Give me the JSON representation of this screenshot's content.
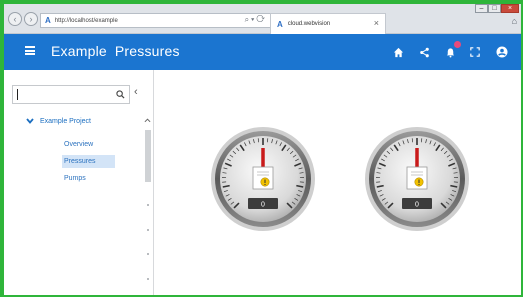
{
  "browser": {
    "url": "http://localhost/example",
    "tab_title": "cloud.webvision",
    "tab_close": "×",
    "window_controls": [
      "–",
      "□",
      "×"
    ]
  },
  "appbar": {
    "title_part1": "Example",
    "title_part2": "Pressures",
    "icons": [
      "home-icon",
      "share-icon",
      "bell-icon",
      "fullscreen-icon",
      "account-icon"
    ],
    "accent_color": "#1b75d0",
    "notification_color": "#e94a7b"
  },
  "sidebar": {
    "search_placeholder": "",
    "tree": {
      "root_label": "Example Project",
      "children": [
        {
          "label": "Overview",
          "active": false
        },
        {
          "label": "Pressures",
          "active": true
        },
        {
          "label": "Pumps",
          "active": false
        }
      ]
    }
  },
  "gauges": [
    {
      "value_label": "0",
      "level": 0
    },
    {
      "value_label": "0",
      "level": 0
    }
  ]
}
